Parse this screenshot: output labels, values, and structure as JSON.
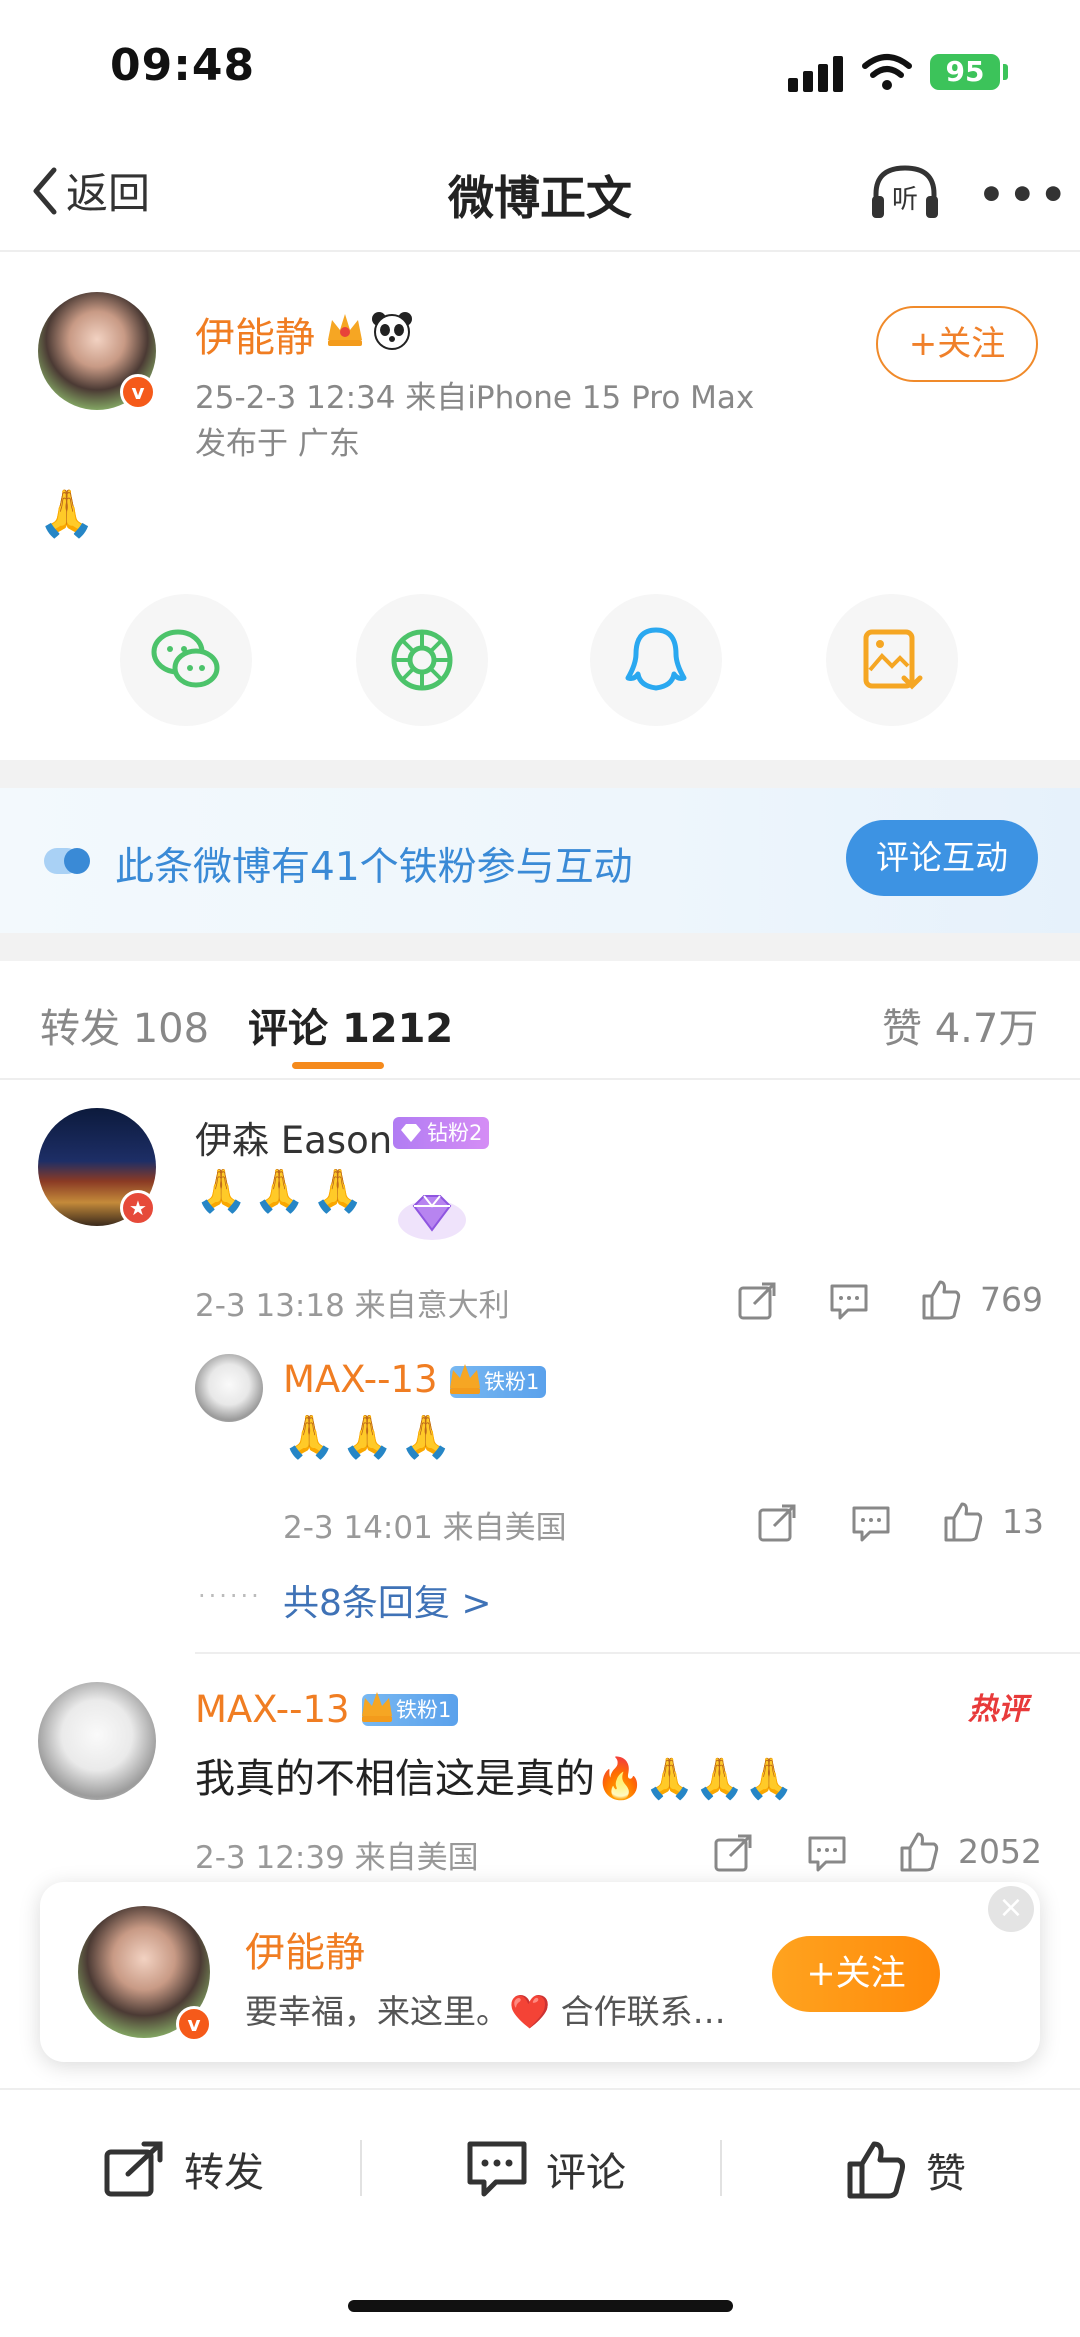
{
  "status_bar": {
    "time": "09:48",
    "battery": "95"
  },
  "nav": {
    "back_label": "返回",
    "title": "微博正文",
    "listen_label": "听"
  },
  "post": {
    "author": {
      "name": "伊能静",
      "avatar_badge": "v"
    },
    "meta": "25-2-3 12:34  来自iPhone 15 Pro Max",
    "location": "发布于 广东",
    "follow_label": "+关注",
    "content": "🙏"
  },
  "share_targets": [
    {
      "name": "wechat-icon",
      "color": "#4cc36a"
    },
    {
      "name": "moments-icon",
      "color": "#4cc36a"
    },
    {
      "name": "qq-icon",
      "color": "#2aa8f0"
    },
    {
      "name": "save-image-icon",
      "color": "#f5a623"
    }
  ],
  "fan_banner": {
    "text": "此条微博有41个铁粉参与互动",
    "button_label": "评论互动"
  },
  "tabs": {
    "repost_label": "转发",
    "repost_count": "108",
    "comment_label": "评论",
    "comment_count": "1212",
    "like_label": "赞",
    "like_count": "4.7万"
  },
  "comments": [
    {
      "user": "伊森 Eason",
      "badge": "钻粉2",
      "content": "🙏🙏🙏",
      "time": "2-3 13:18  来自意大利",
      "likes": "769",
      "reply": {
        "user": "MAX--13",
        "badge": "铁粉1",
        "content": "🙏🙏🙏",
        "time": "2-3 14:01  来自美国",
        "likes": "13"
      },
      "more_replies": "共8条回复 >"
    },
    {
      "user": "MAX--13",
      "badge": "铁粉1",
      "tag": "热评",
      "content": "我真的不相信这是真的🔥🙏🙏🙏",
      "time": "2-3 12:39  来自美国",
      "likes": "2052"
    }
  ],
  "popup": {
    "name": "伊能静",
    "desc": "要幸福，来这里。❤️ 合作联系…",
    "follow_label": "+关注",
    "close_label": "×"
  },
  "bottom_bar": {
    "repost_label": "转发",
    "comment_label": "评论",
    "like_label": "赞"
  }
}
